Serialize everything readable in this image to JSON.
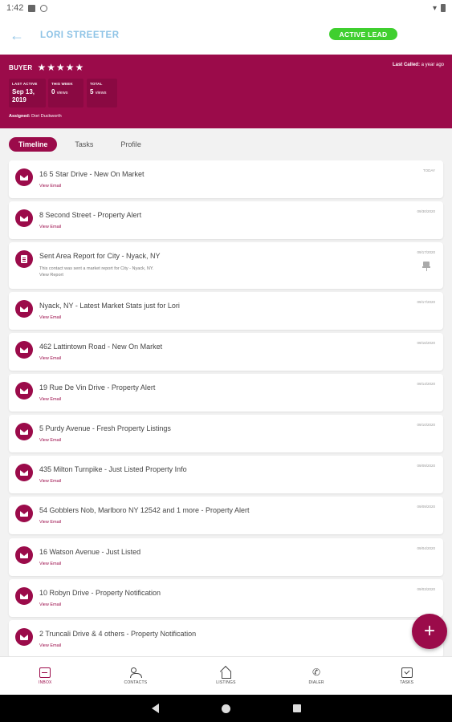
{
  "status_bar": {
    "time": "1:42"
  },
  "app_bar": {
    "title": "LORI STREETER",
    "lead_status": "ACTIVE LEAD"
  },
  "header": {
    "buyer_label": "BUYER",
    "stars": "★★★★★",
    "rating": 5,
    "last_called_label": "Last Called:",
    "last_called_value": "a year ago",
    "stats": [
      {
        "label": "LAST ACTIVE",
        "value": "Sep 13, 2019",
        "unit": ""
      },
      {
        "label": "THIS WEEK",
        "value": "0",
        "unit": "views"
      },
      {
        "label": "TOTAL",
        "value": "5",
        "unit": "views"
      }
    ],
    "assigned_label": "Assigned:",
    "assigned_value": "Dori Duckworth"
  },
  "tabs": [
    {
      "label": "Timeline",
      "active": true
    },
    {
      "label": "Tasks",
      "active": false
    },
    {
      "label": "Profile",
      "active": false
    }
  ],
  "timeline": [
    {
      "title": "16 5 Star Drive - New On Market",
      "link": "View Email",
      "date": "TODAY",
      "type": "email"
    },
    {
      "title": "8 Second Street - Property Alert",
      "link": "View Email",
      "date": "09/30/2020",
      "type": "email"
    },
    {
      "title": "Sent Area Report for City - Nyack, NY",
      "desc": "This contact was sent a market report for City - Nyack, NY.",
      "link": "View Report",
      "date": "09/17/2020",
      "type": "report",
      "pinned": true
    },
    {
      "title": "Nyack, NY - Latest Market Stats just for Lori",
      "link": "View Email",
      "date": "09/17/2020",
      "type": "email"
    },
    {
      "title": "462 Lattintown Road - New On Market",
      "link": "View Email",
      "date": "09/16/2020",
      "type": "email"
    },
    {
      "title": "19 Rue De Vin Drive - Property Alert",
      "link": "View Email",
      "date": "09/14/2020",
      "type": "email"
    },
    {
      "title": "5 Purdy Avenue - Fresh Property Listings",
      "link": "View Email",
      "date": "09/10/2020",
      "type": "email"
    },
    {
      "title": "435 Milton Turnpike - Just Listed Property Info",
      "link": "View Email",
      "date": "09/09/2020",
      "type": "email"
    },
    {
      "title": "54 Gobblers Nob, Marlboro NY 12542 and 1 more - Property Alert",
      "link": "View Email",
      "date": "09/09/2020",
      "type": "email"
    },
    {
      "title": "16 Watson Avenue - Just Listed",
      "link": "View Email",
      "date": "09/04/2020",
      "type": "email"
    },
    {
      "title": "10 Robyn Drive - Property Notification",
      "link": "View Email",
      "date": "09/03/2020",
      "type": "email"
    },
    {
      "title": "2 Truncali Drive & 4 others - Property Notification",
      "link": "View Email",
      "date": "",
      "type": "email"
    }
  ],
  "fab": {
    "label": "+"
  },
  "bottom_nav": [
    {
      "label": "INBOX",
      "icon": "inbox-icon",
      "active": true
    },
    {
      "label": "CONTACTS",
      "icon": "contacts-icon",
      "active": false
    },
    {
      "label": "LISTINGS",
      "icon": "home-icon",
      "active": false
    },
    {
      "label": "DIALER",
      "icon": "phone-icon",
      "active": false
    },
    {
      "label": "TASKS",
      "icon": "tasks-icon",
      "active": false
    }
  ],
  "colors": {
    "brand": "#9b0b4a",
    "active_lead": "#3fcf2f",
    "title_blue": "#8ec3e6"
  }
}
